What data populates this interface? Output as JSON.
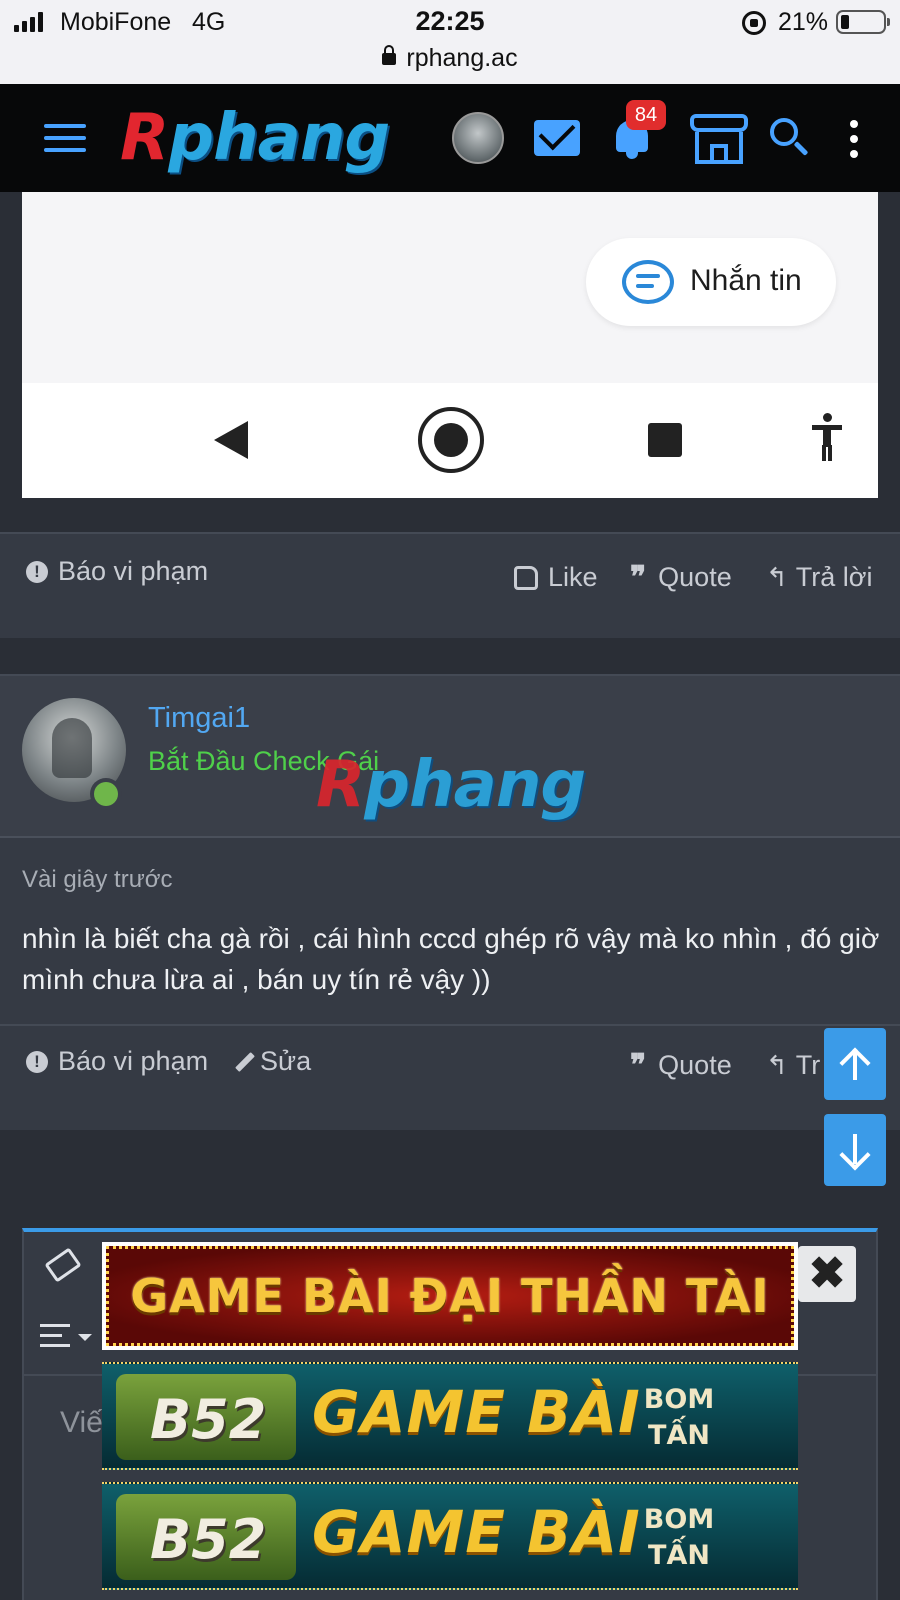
{
  "status_bar": {
    "carrier": "MobiFone",
    "network": "4G",
    "time": "22:25",
    "battery": "21%",
    "url": "rphang.ac"
  },
  "header": {
    "logo_first": "R",
    "logo_rest": "phang",
    "notification_count": "84"
  },
  "embedded_screenshot": {
    "message_button": "Nhắn tin"
  },
  "post1_actions": {
    "report": "Báo vi phạm",
    "like": "Like",
    "quote": "Quote",
    "reply": "Trả lời"
  },
  "post2": {
    "username": "Timgai1",
    "user_title": "Bắt Đầu Check Gái",
    "watermark_first": "R",
    "watermark_rest": "phang",
    "time": "Vài giây trước",
    "content": "nhìn là biết cha gà rồi , cái hình cccd ghép rõ vậy mà ko nhìn , đó giờ mình chưa lừa ai , bán uy tín rẻ vậy ))",
    "actions": {
      "report": "Báo vi phạm",
      "edit": "Sửa",
      "quote": "Quote",
      "reply": "Tr"
    }
  },
  "editor": {
    "placeholder": "Viế"
  },
  "ads": [
    {
      "text": "GAME BÀI  ĐẠI THẦN TÀI"
    },
    {
      "logo": "B52",
      "text": "GAME BÀI",
      "tag": "BOM TẤN"
    },
    {
      "logo": "B52",
      "text": "GAME BÀI",
      "tag": "BOM TẤN"
    }
  ],
  "colors": {
    "accent": "#48a2ff",
    "link": "#52a8f2",
    "user_title": "#4fd04a",
    "badge": "#e12d2d",
    "background": "#2a2e36",
    "panel": "#353a44"
  }
}
